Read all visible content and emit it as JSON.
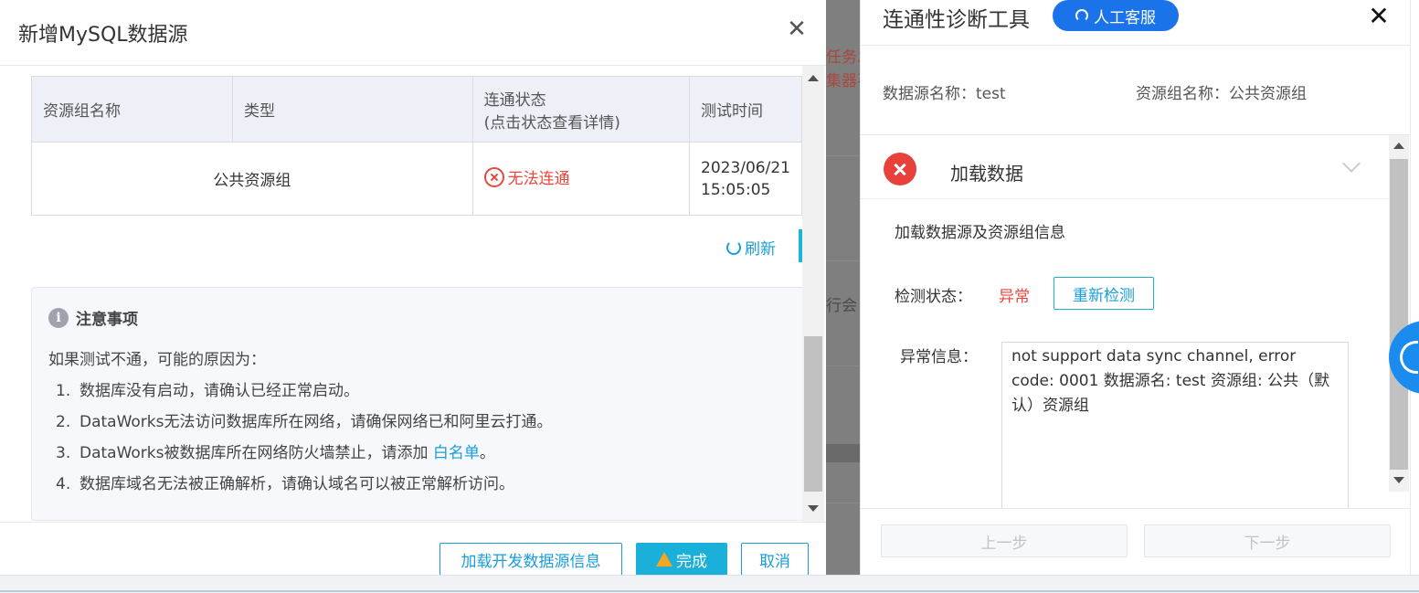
{
  "modal": {
    "title": "新增MySQL数据源",
    "close": "✕",
    "table": {
      "headers": {
        "resource_group": "资源组名称",
        "type": "类型",
        "status_line1": "连通状态",
        "status_line2": "(点击状态查看详情)",
        "test_time": "测试时间"
      },
      "rows": [
        {
          "resource_group": "公共资源组",
          "type": "",
          "status": "无法连通",
          "date": "2023/06/21",
          "time": "15:05:05"
        }
      ]
    },
    "refresh_label": "刷新",
    "notice": {
      "title": "注意事项",
      "intro": "如果测试不通，可能的原因为：",
      "items": [
        {
          "num": "1.",
          "text": "数据库没有启动，请确认已经正常启动。"
        },
        {
          "num": "2.",
          "text": "DataWorks无法访问数据库所在网络，请确保网络已和阿里云打通。"
        },
        {
          "num": "3.",
          "text": "DataWorks被数据库所在网络防火墙禁止，请添加 ",
          "link": "白名单",
          "after": "。"
        },
        {
          "num": "4.",
          "text": "数据库域名无法被正确解析，请确认域名可以被正常解析访问。"
        }
      ]
    },
    "footer": {
      "load_dev": "加载开发数据源信息",
      "done": "完成",
      "cancel": "取消"
    }
  },
  "background": {
    "red_line1": "任务发",
    "red_line2": "集器不",
    "gray_text": "行会"
  },
  "drawer": {
    "title": "连通性诊断工具",
    "customer_service": "人工客服",
    "close": "✕",
    "datasource_label": "数据源名称：",
    "datasource_value": "test",
    "resource_group_label": "资源组名称：",
    "resource_group_value": "公共资源组",
    "step": {
      "title": "加载数据",
      "description": "加载数据源及资源组信息",
      "detect_label": "检测状态：",
      "detect_status": "异常",
      "redetect": "重新检测",
      "error_label": "异常信息：",
      "error_text": "not support data sync channel, error code: 0001 数据源名: test 资源组: 公共（默认）资源组"
    },
    "prev": "上一步",
    "next": "下一步"
  },
  "colors": {
    "accent": "#1a9dd9",
    "primary": "#1ab0d9",
    "error": "#e8473e",
    "cs_button": "#1a73e8"
  }
}
